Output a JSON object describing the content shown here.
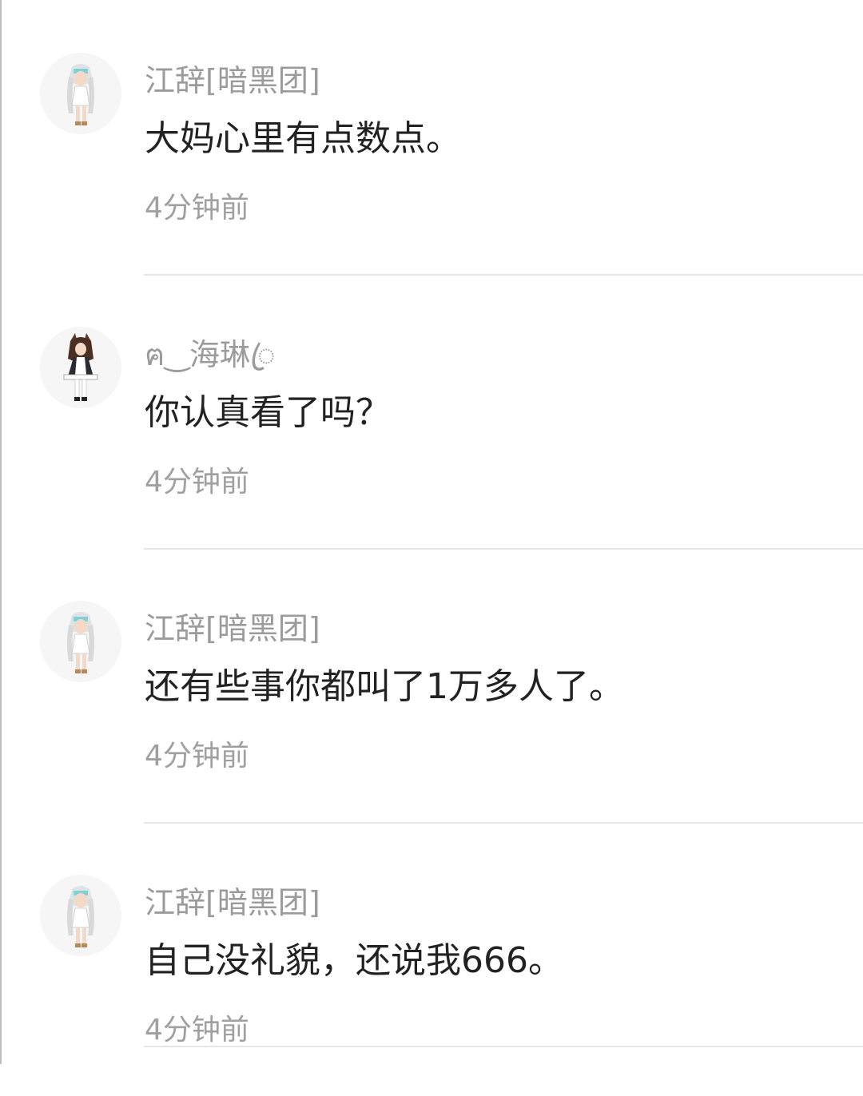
{
  "comments": [
    {
      "username": "江辞[暗黑团]",
      "text": "大妈心里有点数点。",
      "time": "4分钟前",
      "avatar_icon": "anime-girl-white-avatar"
    },
    {
      "username": "ฅ‿海琳ꦿ",
      "text": "你认真看了吗？",
      "time": "4分钟前",
      "avatar_icon": "anime-girl-maid-avatar"
    },
    {
      "username": "江辞[暗黑团]",
      "text": "还有些事你都叫了1万多人了。",
      "time": "4分钟前",
      "avatar_icon": "anime-girl-white-avatar"
    },
    {
      "username": "江辞[暗黑团]",
      "text": "自己没礼貌，还说我666。",
      "time": "4分钟前",
      "avatar_icon": "anime-girl-white-avatar"
    }
  ]
}
